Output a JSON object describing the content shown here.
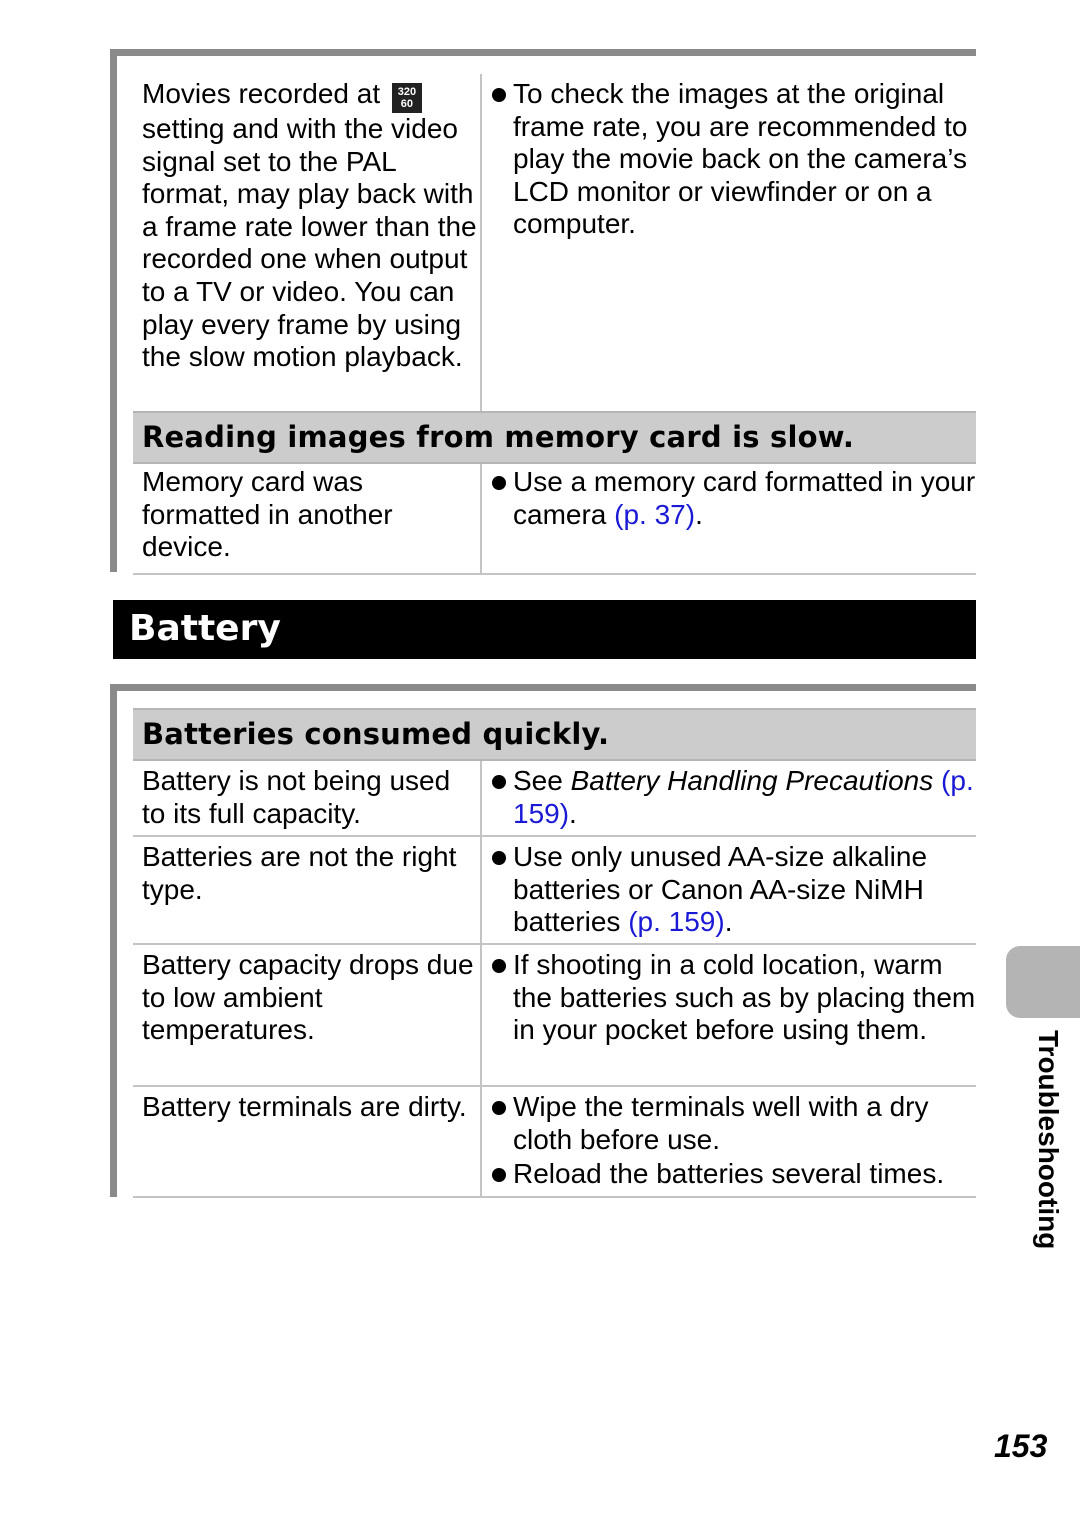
{
  "section1": {
    "rows": [
      {
        "cause_before_icon": "Movies recorded at",
        "icon": "movie-320-60-icon",
        "icon_top": "320",
        "icon_bottom": "60",
        "cause_after_icon": "setting and with the video signal set to the PAL format, may play back with a frame rate lower than the recorded one when output to a TV or video. You can play every frame by using the slow motion playback.",
        "remedy": "To check the images at the original frame rate, you are recommended to play the movie back on the camera’s LCD monitor or viewfinder or on a computer."
      }
    ],
    "subheading": "Reading images from memory card is slow.",
    "rows2": [
      {
        "cause": "Memory card was formatted in another device.",
        "remedy_text": "Use a memory card formatted in your camera",
        "remedy_link": "(p. 37)",
        "remedy_end": "."
      }
    ]
  },
  "section_title": "Battery",
  "section2": {
    "subheading": "Batteries consumed quickly.",
    "rows": [
      {
        "cause": "Battery is not being used to its full capacity.",
        "remedy_prefix": "See ",
        "remedy_italic": "Battery Handling Precautions",
        "remedy_link": "(p. 159)",
        "remedy_end": "."
      },
      {
        "cause": "Batteries are not the right type.",
        "remedy_text": "Use only unused AA-size alkaline batteries or Canon AA-size NiMH batteries",
        "remedy_link": "(p. 159)",
        "remedy_end": "."
      },
      {
        "cause": "Battery capacity drops due to low ambient temperatures.",
        "remedy": "If shooting in a cold location, warm the batteries such as by placing them in your pocket before using them."
      },
      {
        "cause": "Battery terminals are dirty.",
        "remedies": [
          "Wipe the terminals well with a dry cloth before use.",
          "Reload the batteries several times."
        ]
      }
    ]
  },
  "side_tab_label": "Troubleshooting",
  "page_number": "153",
  "colors": {
    "link": "#1a1ad6",
    "subheading_bg": "#cccccc",
    "section_bar_bg": "#000000",
    "frame_border": "#8a8a8a",
    "side_tab": "#b4b4b4"
  }
}
